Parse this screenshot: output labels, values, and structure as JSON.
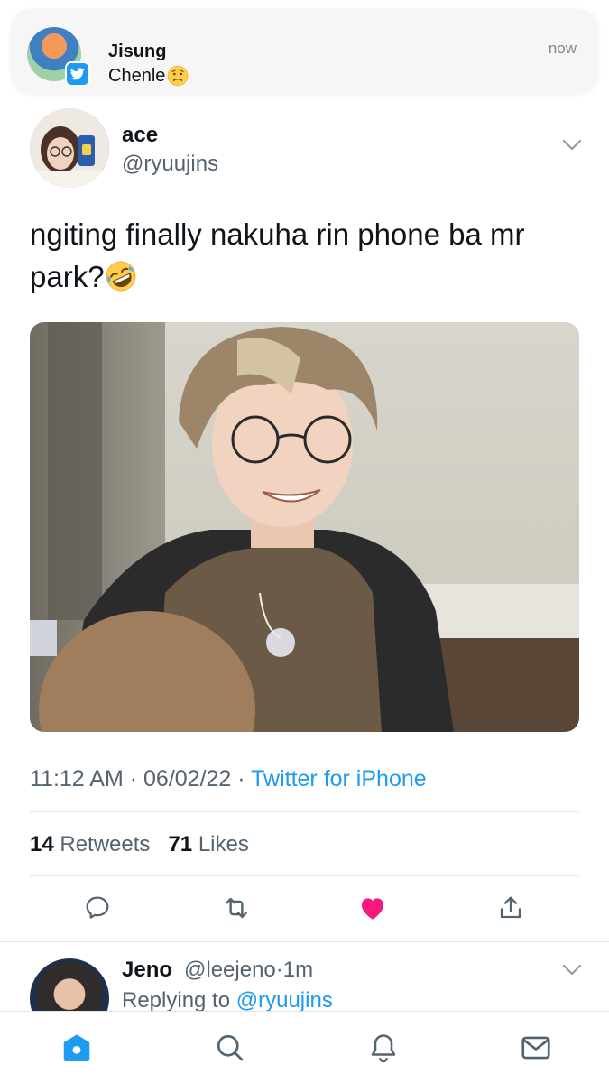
{
  "notification": {
    "title": "Jisung",
    "body": "Chenle",
    "time": "now",
    "icons": {
      "app": "twitter-bird-icon",
      "emoji": "worried-face-emoji"
    }
  },
  "tweet": {
    "author_name": "ace",
    "author_handle": "@ryuujins",
    "text": "ngiting finally nakuha rin phone ba mr park?",
    "emoji": "rolling-on-floor-laughing-emoji",
    "time": "11:12 AM",
    "date": "06/02/22",
    "separator": "·",
    "source": "Twitter for iPhone",
    "retweets_count": "14",
    "retweets_label": "Retweets",
    "likes_count": "71",
    "likes_label": "Likes",
    "liked": true
  },
  "reply": {
    "name": "Jeno",
    "handle": "@leejeno",
    "separator": "·",
    "age": "1m",
    "replying_prefix": "Replying to",
    "replying_to": "@ryuujins"
  },
  "tabbar": {
    "tabs": [
      "home-icon",
      "search-icon",
      "notifications-bell-icon",
      "messages-envelope-icon"
    ]
  },
  "colors": {
    "accent": "#1d9bf0",
    "like": "#f91880",
    "secondary_text": "#536471",
    "text": "#0f1419"
  }
}
